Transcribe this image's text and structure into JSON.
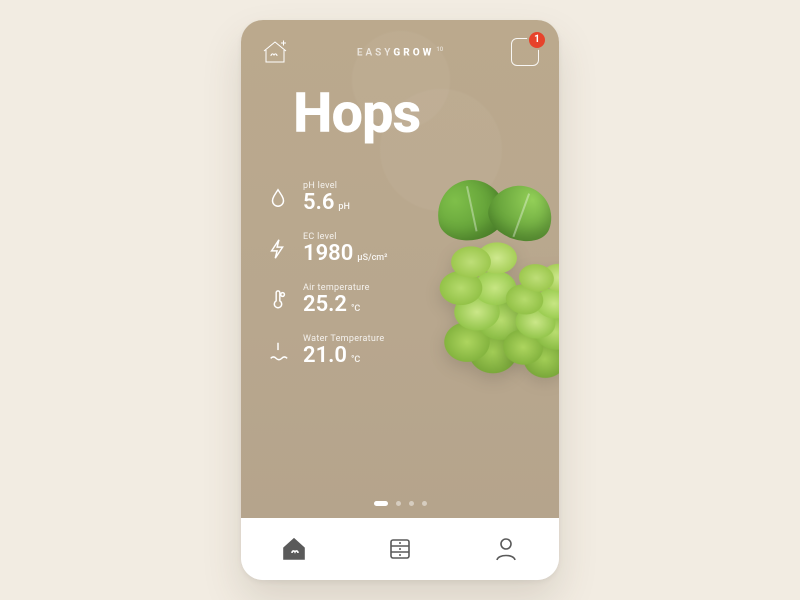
{
  "header": {
    "brand_easy": "EASY",
    "brand_grow": "GROW",
    "brand_sup": "10",
    "notification_count": "1"
  },
  "plant": {
    "title": "Hops"
  },
  "metrics": {
    "ph": {
      "label": "pH level",
      "value": "5.6",
      "unit": "pH"
    },
    "ec": {
      "label": "EC level",
      "value": "1980",
      "unit": "µS/cm²"
    },
    "airtmp": {
      "label": "Air temperature",
      "value": "25.2",
      "unit": "°C"
    },
    "wtrtmp": {
      "label": "Water Temperature",
      "value": "21.0",
      "unit": "°C"
    }
  },
  "pager": {
    "count": 4,
    "active": 0
  },
  "tabs": {
    "home": {
      "active": true
    },
    "storage": {
      "active": false
    },
    "profile": {
      "active": false
    }
  }
}
